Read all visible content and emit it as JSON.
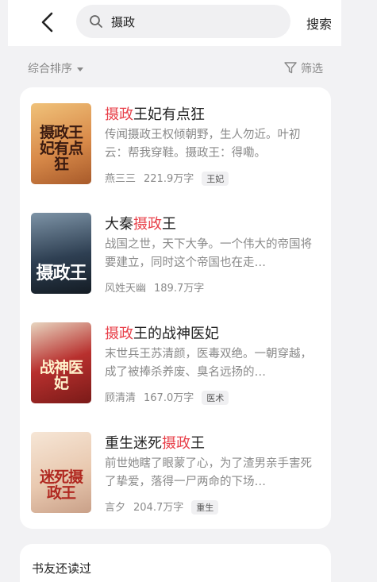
{
  "header": {
    "search_query": "摄政",
    "search_button": "搜索"
  },
  "filter": {
    "sort_label": "综合排序",
    "filter_label": "筛选"
  },
  "books": [
    {
      "title_before": "",
      "title_highlight": "摄政",
      "title_after": "王妃有点狂",
      "description": "传闻摄政王权倾朝野，生人勿近。叶初云：帮我穿鞋。摄政王：得嘞。",
      "author": "燕三三",
      "word_count": "221.9万字",
      "tag": "王妃",
      "cover_text": "摄政王妃有点狂",
      "cover_color": "#d98b4a"
    },
    {
      "title_before": "大秦",
      "title_highlight": "摄政",
      "title_after": "王",
      "description": "战国之世，天下大争。一个伟大的帝国将要建立，同时这个帝国也在走…",
      "author": "风姓天幽",
      "word_count": "189.7万字",
      "tag": "",
      "cover_text": "摄政王",
      "cover_color": "#2e3f52"
    },
    {
      "title_before": "",
      "title_highlight": "摄政",
      "title_after": "王的战神医妃",
      "description": "末世兵王苏清颜，医毒双绝。一朝穿越，成了被捧杀养废、臭名远扬的…",
      "author": "顾清清",
      "word_count": "167.0万字",
      "tag": "医术",
      "cover_text": "战神医妃",
      "cover_color": "#b8302e"
    },
    {
      "title_before": "重生迷死",
      "title_highlight": "摄政",
      "title_after": "王",
      "description": "前世她瞎了眼蒙了心，为了渣男亲手害死了挚爱，落得一尸两命的下场…",
      "author": "言夕",
      "word_count": "204.7万字",
      "tag": "重生",
      "cover_text": "迷死摄政王",
      "cover_color": "#e9c9b0"
    }
  ],
  "section2": {
    "title": "书友还读过"
  },
  "colors": {
    "highlight": "#e8404a",
    "background": "#f2f2f4"
  }
}
